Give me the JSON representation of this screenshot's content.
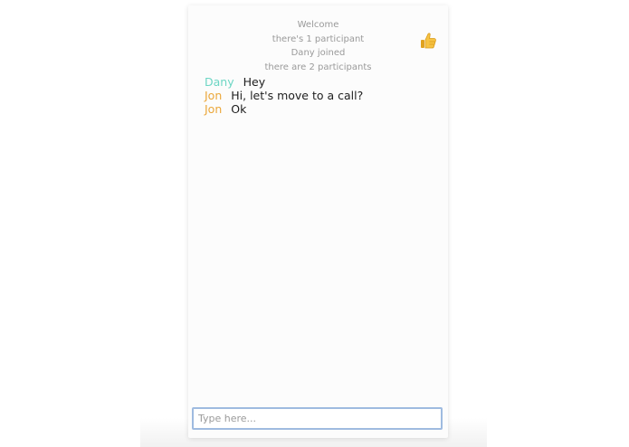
{
  "system_messages": [
    "Welcome",
    "there's 1 participant",
    "Dany joined",
    "there are 2 participants"
  ],
  "reaction_icon": "thumbs-up-icon",
  "messages": [
    {
      "author": "Dany",
      "text": "Hey",
      "color": "#6dd6c4"
    },
    {
      "author": "Jon",
      "text": "Hi, let's move to a call?",
      "color": "#eba73a"
    },
    {
      "author": "Jon",
      "text": "Ok",
      "color": "#eba73a"
    }
  ],
  "composer": {
    "placeholder": "Type here...",
    "value": ""
  },
  "colors": {
    "focus_border": "#9fbbe0",
    "system_text": "#9a9a9a"
  }
}
